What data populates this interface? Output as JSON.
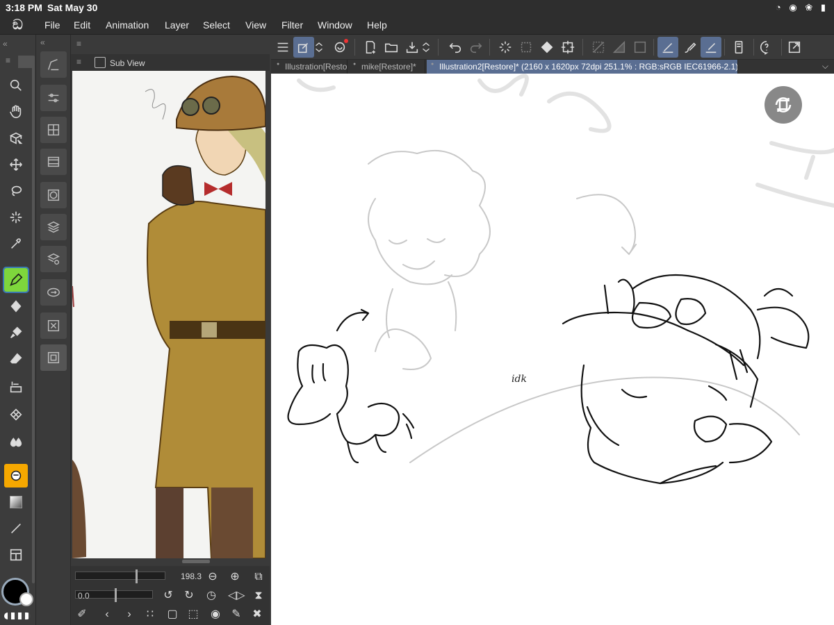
{
  "status": {
    "time": "3:18 PM",
    "date": "Sat May 30"
  },
  "menu": [
    "File",
    "Edit",
    "Animation",
    "Layer",
    "Select",
    "View",
    "Filter",
    "Window",
    "Help"
  ],
  "subview": {
    "title": "Sub View",
    "zoom": "198.3",
    "rotation": "0.0"
  },
  "tabs": [
    {
      "label": "Illustration[Restore]*"
    },
    {
      "label": "mike[Restore]*"
    },
    {
      "label": "Illustration2[Restore]* (2160 x 1620px 72dpi 251.1% : RGB:sRGB IEC61966-2.1)"
    }
  ],
  "canvas": {
    "note_text": "idk"
  },
  "colors": {
    "main": "#000000",
    "sub": "#ffffff",
    "accent": "#5a6e92",
    "pen_active": "#7ed63c"
  },
  "icons": {
    "tools": [
      "zoom",
      "hand",
      "operation",
      "move",
      "lasso",
      "magic-wand",
      "eyedropper",
      "pen",
      "pencil",
      "brush",
      "eraser",
      "fill",
      "gradient-pattern",
      "blend",
      "figure",
      "text",
      "line",
      "frame"
    ],
    "toolbar": [
      "menu",
      "select-tool",
      "snap",
      "new-file",
      "open",
      "save",
      "undo",
      "redo",
      "clear",
      "transform",
      "fill",
      "free-transform",
      "rulers",
      "pen-pressure",
      "help",
      "fullscreen"
    ]
  }
}
